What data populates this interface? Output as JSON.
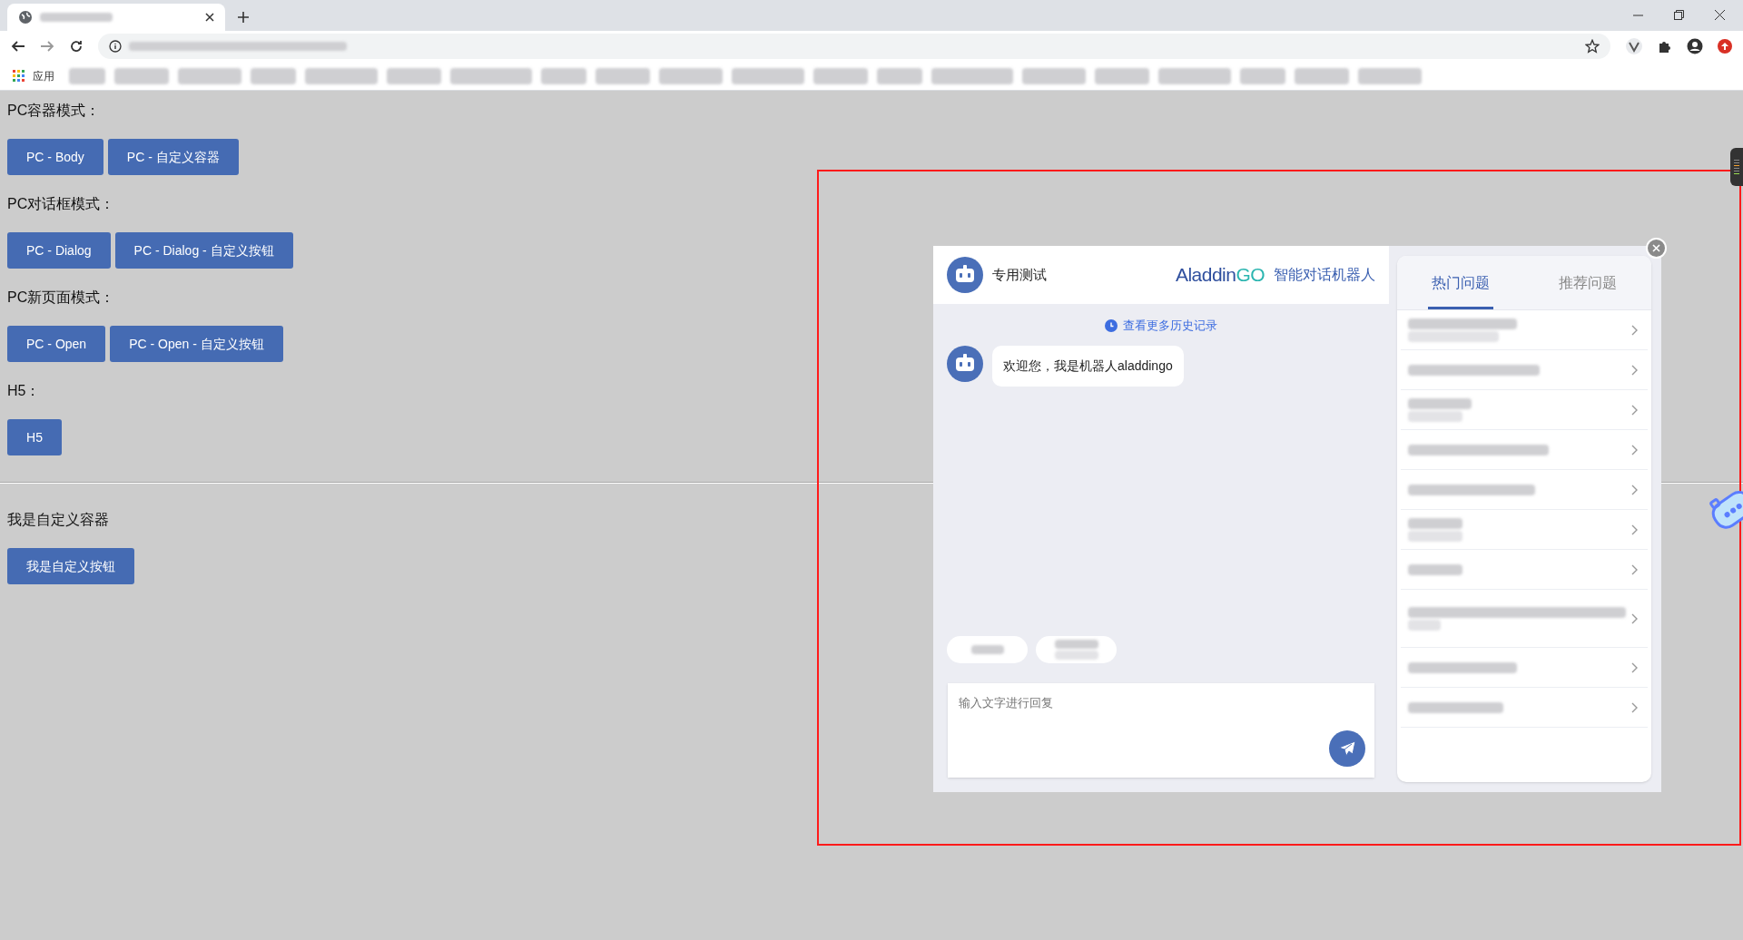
{
  "browser": {
    "bookmarks_apps_label": "应用"
  },
  "sections": [
    {
      "label": "PC容器模式：",
      "buttons": [
        "PC - Body",
        "PC - 自定义容器"
      ]
    },
    {
      "label": "PC对话框模式：",
      "buttons": [
        "PC - Dialog",
        "PC - Dialog - 自定义按钮"
      ]
    },
    {
      "label": "PC新页面模式：",
      "buttons": [
        "PC - Open",
        "PC - Open - 自定义按钮"
      ]
    },
    {
      "label": "H5：",
      "buttons": [
        "H5"
      ]
    }
  ],
  "custom_container": {
    "label": "我是自定义容器",
    "button": "我是自定义按钮"
  },
  "chat": {
    "bot_name": "专用测试",
    "brand_name": "Aladdin",
    "brand_suffix": "GO",
    "subtitle": "智能对话机器人",
    "history_link": "查看更多历史记录",
    "messages": [
      {
        "text": "欢迎您，我是机器人aladdingo"
      }
    ],
    "input": {
      "placeholder": "输入文字进行回复"
    },
    "tabs": [
      {
        "label": "热门问题",
        "selected": true
      },
      {
        "label": "推荐问题",
        "selected": false
      }
    ]
  }
}
